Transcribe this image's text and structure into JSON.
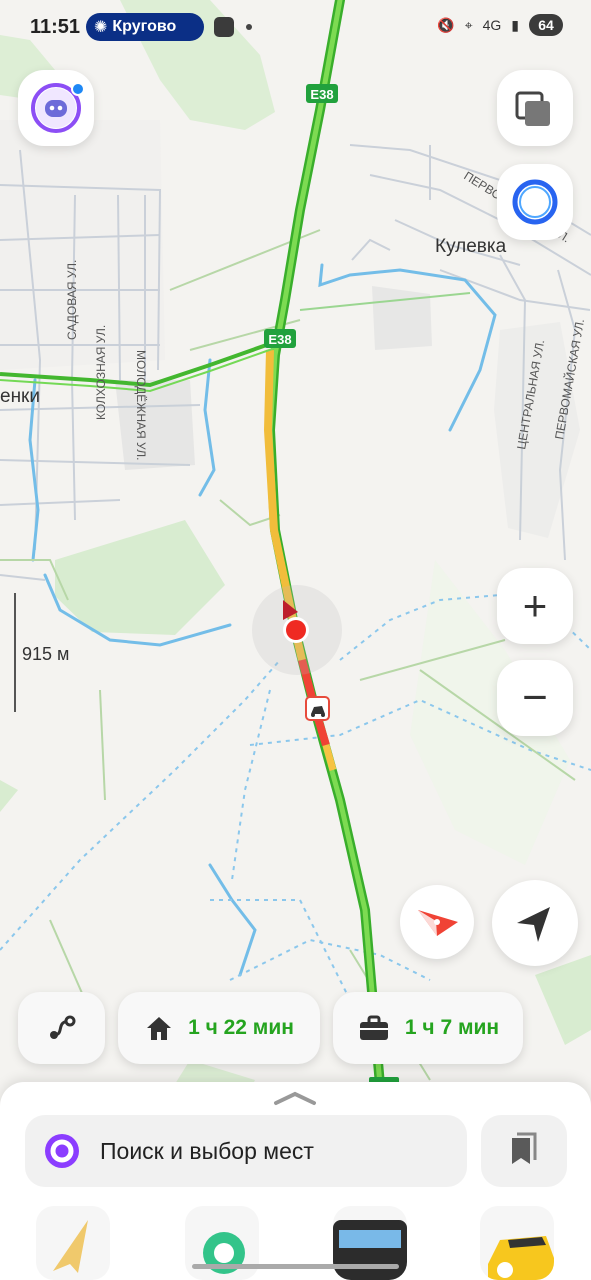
{
  "status_bar": {
    "time": "11:51",
    "notification_text": "Кругово",
    "network": "4G",
    "battery": "64"
  },
  "map": {
    "road_label_top": "E38",
    "road_label_middle": "E38",
    "place_kulevka": "Кулевка",
    "place_left": "енки",
    "street_sadovaya": "САДОВАЯ УЛ.",
    "street_molodezhnaya": "МОЛОДЁЖНАЯ УЛ.",
    "street_kolkhoznaya": "КОЛХОЗНАЯ УЛ.",
    "street_pervomayskaya_top": "ПЕРВОМАЙСКАЯ УЛ.",
    "street_tsentralnaya": "ЦЕНТРАЛЬНАЯ УЛ.",
    "street_pervomayskaya_right": "ПЕРВОМАЙСКАЯ УЛ.",
    "scale_label": "915 м",
    "colors": {
      "road_green": "#45bf2f",
      "road_yellow": "#f6c343",
      "road_red": "#ef4438",
      "water": "#72bde7",
      "park": "#d8ecd0"
    }
  },
  "controls": {
    "zoom_in": "+",
    "zoom_out": "−"
  },
  "routes": {
    "home_time": "1 ч 22 мин",
    "work_time": "1 ч 7 мин"
  },
  "search": {
    "placeholder": "Поиск и выбор мест"
  }
}
